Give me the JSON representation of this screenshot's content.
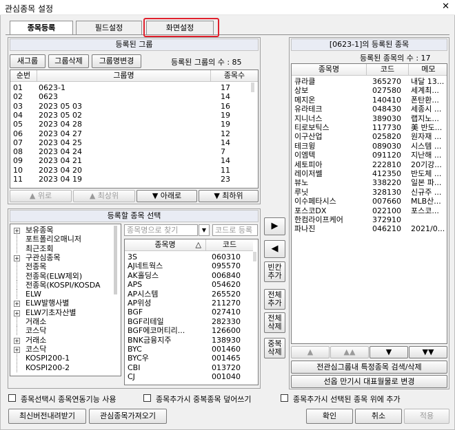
{
  "window": {
    "title": "관심종목 설정",
    "close": "✕"
  },
  "tabs": [
    {
      "label": "종목등록",
      "active": true
    },
    {
      "label": "필드설정",
      "active": false
    },
    {
      "label": "화면설정",
      "active": false
    }
  ],
  "groups_panel": {
    "header": "등록된 그룹",
    "new_group": "새그룹",
    "delete_group": "그룹삭제",
    "rename_group": "그룹명변경",
    "count_text": "등록된 그룹의 수 : 85",
    "columns": [
      "순번",
      "그룹명",
      "종목수"
    ],
    "rows": [
      [
        "01",
        "0623-1",
        "17"
      ],
      [
        "02",
        "0623",
        "14"
      ],
      [
        "03",
        "2023 05 03",
        "16"
      ],
      [
        "04",
        "2023 05 02",
        "19"
      ],
      [
        "05",
        "2023 04 28",
        "19"
      ],
      [
        "06",
        "2023 04 27",
        "12"
      ],
      [
        "07",
        "2023 04 25",
        "14"
      ],
      [
        "08",
        "2023 04 24",
        "7"
      ],
      [
        "09",
        "2023 04 21",
        "14"
      ],
      [
        "10",
        "2023 04 20",
        "11"
      ],
      [
        "11",
        "2023 04 19",
        "23"
      ]
    ],
    "move_up": "▲ 위로",
    "move_top": "▲ 최상위",
    "move_down": "▼ 아래로",
    "move_bottom": "▼ 최하위"
  },
  "select_panel": {
    "header": "등록할 종목 선택",
    "tree": [
      {
        "label": "보유종목",
        "expandable": true,
        "indent": 0
      },
      {
        "label": "포트폴리오매니저",
        "expandable": false,
        "indent": 0
      },
      {
        "label": "최근조회",
        "expandable": false,
        "indent": 0
      },
      {
        "label": "구관심종목",
        "expandable": true,
        "indent": 0
      },
      {
        "label": "전종목",
        "expandable": false,
        "indent": 0
      },
      {
        "label": "전종목(ELW제외)",
        "expandable": false,
        "indent": 0
      },
      {
        "label": "전종목(KOSPI/KOSDA",
        "expandable": false,
        "indent": 0
      },
      {
        "label": "ELW",
        "expandable": false,
        "indent": 0
      },
      {
        "label": "ELW발행사별",
        "expandable": true,
        "indent": 0
      },
      {
        "label": "ELW기초자산별",
        "expandable": true,
        "indent": 0
      },
      {
        "label": "거래소",
        "expandable": false,
        "indent": 0
      },
      {
        "label": "코스닥",
        "expandable": false,
        "indent": 0
      },
      {
        "label": "거래소",
        "expandable": true,
        "indent": 0
      },
      {
        "label": "코스닥",
        "expandable": true,
        "indent": 0
      },
      {
        "label": "KOSPI200-1",
        "expandable": false,
        "indent": 0
      },
      {
        "label": "KOSPI200-2",
        "expandable": false,
        "indent": 0
      }
    ],
    "name_placeholder": "종목명으로 찾기",
    "code_placeholder": "코드로 등록",
    "columns": [
      "종목명",
      "코드"
    ],
    "sort_glyph": "△",
    "rows": [
      [
        "3S",
        "060310"
      ],
      [
        "AJ네트웍스",
        "095570"
      ],
      [
        "AK홀딩스",
        "006840"
      ],
      [
        "APS",
        "054620"
      ],
      [
        "AP시스템",
        "265520"
      ],
      [
        "AP위성",
        "211270"
      ],
      [
        "BGF",
        "027410"
      ],
      [
        "BGF리테일",
        "282330"
      ],
      [
        "BGF에코머티리...",
        "126600"
      ],
      [
        "BNK금융지주",
        "138930"
      ],
      [
        "BYC",
        "001460"
      ],
      [
        "BYC우",
        "001465"
      ],
      [
        "CBI",
        "013720"
      ],
      [
        "CJ",
        "001040"
      ]
    ]
  },
  "middle_buttons": {
    "add": "▶",
    "remove": "◀",
    "add_blank": [
      "빈칸",
      "추가"
    ],
    "add_all": [
      "전체",
      "추가"
    ],
    "delete_all": [
      "전체",
      "삭제"
    ],
    "delete_dup": [
      "중복",
      "삭제"
    ]
  },
  "registered_panel": {
    "header": "[0623-1]의 등록된 종목",
    "count_text": "등록된 종목의 수 : 17",
    "columns": [
      "종목명",
      "코드",
      "메모"
    ],
    "rows": [
      [
        "큐라클",
        "365270",
        "내달 13..."
      ],
      [
        "상보",
        "027580",
        "세계최..."
      ],
      [
        "메지온",
        "140410",
        "폰탄환..."
      ],
      [
        "유라테크",
        "048430",
        "세종시 ..."
      ],
      [
        "지니너스",
        "389030",
        "랩지노..."
      ],
      [
        "티로보틱스",
        "117730",
        "美 반도..."
      ],
      [
        "이구산업",
        "025820",
        "원자재 ..."
      ],
      [
        "테크윙",
        "089030",
        "시스템 ..."
      ],
      [
        "이엠텍",
        "091120",
        "지난해 ..."
      ],
      [
        "세토피아",
        "222810",
        "20기강..."
      ],
      [
        "레이저쎌",
        "412350",
        "반도체 ..."
      ],
      [
        "뷰노",
        "338220",
        "일본 파..."
      ],
      [
        "루닛",
        "328130",
        "신규주 ..."
      ],
      [
        "이수페타시스",
        "007660",
        "MLB산..."
      ],
      [
        "포스코DX",
        "022100",
        "포스코..."
      ],
      [
        "한컴라이프케어",
        "372910",
        ""
      ],
      [
        "파나진",
        "046210",
        "2021/0..."
      ]
    ],
    "nav": [
      "▲",
      "▲▲",
      "▼",
      "▼▼"
    ],
    "search_btn": "전관심그룹내 특정종목 검색/삭제",
    "replace_btn": "선옵 만기시 대표월물로 변경"
  },
  "options": [
    "종목선택시 종목연동기능 사용",
    "종목추가시 중복종목 덮어쓰기",
    "종목추가시 선택된 종목 위에 추가"
  ],
  "footer": {
    "download": "최신버전내려받기",
    "import": "관심종목가져오기",
    "ok": "확인",
    "cancel": "취소",
    "apply": "적용"
  }
}
